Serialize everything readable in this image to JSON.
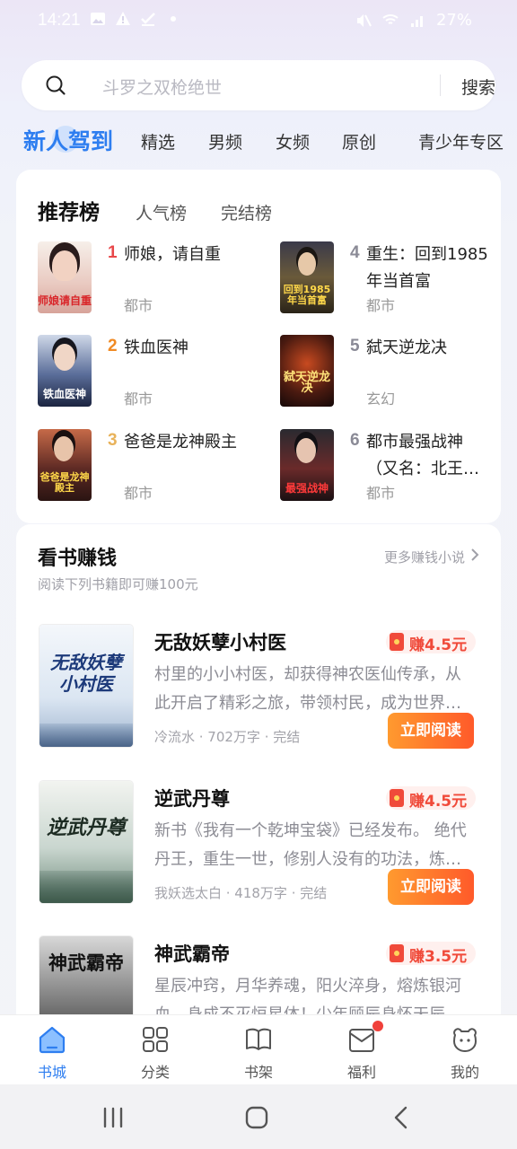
{
  "status_bar": {
    "time": "14:21",
    "battery": "27%"
  },
  "search": {
    "placeholder": "斗罗之双枪绝世",
    "button": "搜索"
  },
  "tabs": [
    {
      "label": "新人驾到"
    },
    {
      "label": "精选"
    },
    {
      "label": "男频"
    },
    {
      "label": "女频"
    },
    {
      "label": "原创"
    },
    {
      "label": "青少年专区"
    }
  ],
  "ranking": {
    "tabs": [
      "推荐榜",
      "人气榜",
      "完结榜"
    ],
    "items": [
      {
        "rank": "1",
        "title": "师娘，请自重",
        "genre": "都市",
        "cover_text": "师娘请自重"
      },
      {
        "rank": "2",
        "title": "铁血医神",
        "genre": "都市",
        "cover_text": "铁血医神"
      },
      {
        "rank": "3",
        "title": "爸爸是龙神殿主",
        "genre": "都市",
        "cover_text": "爸爸是龙神殿主"
      },
      {
        "rank": "4",
        "title": "重生：回到1985年当首富",
        "genre": "都市",
        "cover_text": "回到1985年当首富"
      },
      {
        "rank": "5",
        "title": "弑天逆龙决",
        "genre": "玄幻",
        "cover_text": "弑天逆龙决"
      },
      {
        "rank": "6",
        "title": "都市最强战神（又名：北王…",
        "genre": "都市",
        "cover_text": "最强战神"
      }
    ],
    "rank_colors": {
      "1": "#e8484a",
      "2": "#f08a24",
      "3": "#e8b25a",
      "other": "#8a8a96"
    }
  },
  "earn": {
    "title": "看书赚钱",
    "subtitle": "阅读下列书籍即可赚100元",
    "more": "更多赚钱小说",
    "read_label": "立即阅读",
    "books": [
      {
        "title": "无敌妖孽小村医",
        "desc": "村里的小小村医，却获得神农医仙传承，从此开启了精彩之旅，带领村民，成为世界…",
        "meta": "冷流水 · 702万字 · 完结",
        "earn": "赚4.5元",
        "cover_text": "无敌妖孽小村医"
      },
      {
        "title": "逆武丹尊",
        "desc": "新书《我有一个乾坤宝袋》已经发布。 绝代丹王，重生一世，修别人没有的功法，炼…",
        "meta": "我妖选太白 · 418万字 · 完结",
        "earn": "赚4.5元",
        "cover_text": "逆武丹尊"
      },
      {
        "title": "神武霸帝",
        "desc": "星辰冲窍，月华养魂，阳火淬身，熔炼银河血，身成不灭恒星体！少年顾辰身怀天辰…",
        "meta": "",
        "earn": "赚3.5元",
        "cover_text": "神武霸帝"
      }
    ]
  },
  "bottom_nav": [
    {
      "label": "书城",
      "icon": "home-icon"
    },
    {
      "label": "分类",
      "icon": "grid-icon"
    },
    {
      "label": "书架",
      "icon": "book-icon"
    },
    {
      "label": "福利",
      "icon": "mail-icon"
    },
    {
      "label": "我的",
      "icon": "profile-icon"
    }
  ],
  "colors": {
    "accent": "#2e7ef0",
    "earn_red": "#f04a3a",
    "read_button": "#ff6a2c"
  }
}
